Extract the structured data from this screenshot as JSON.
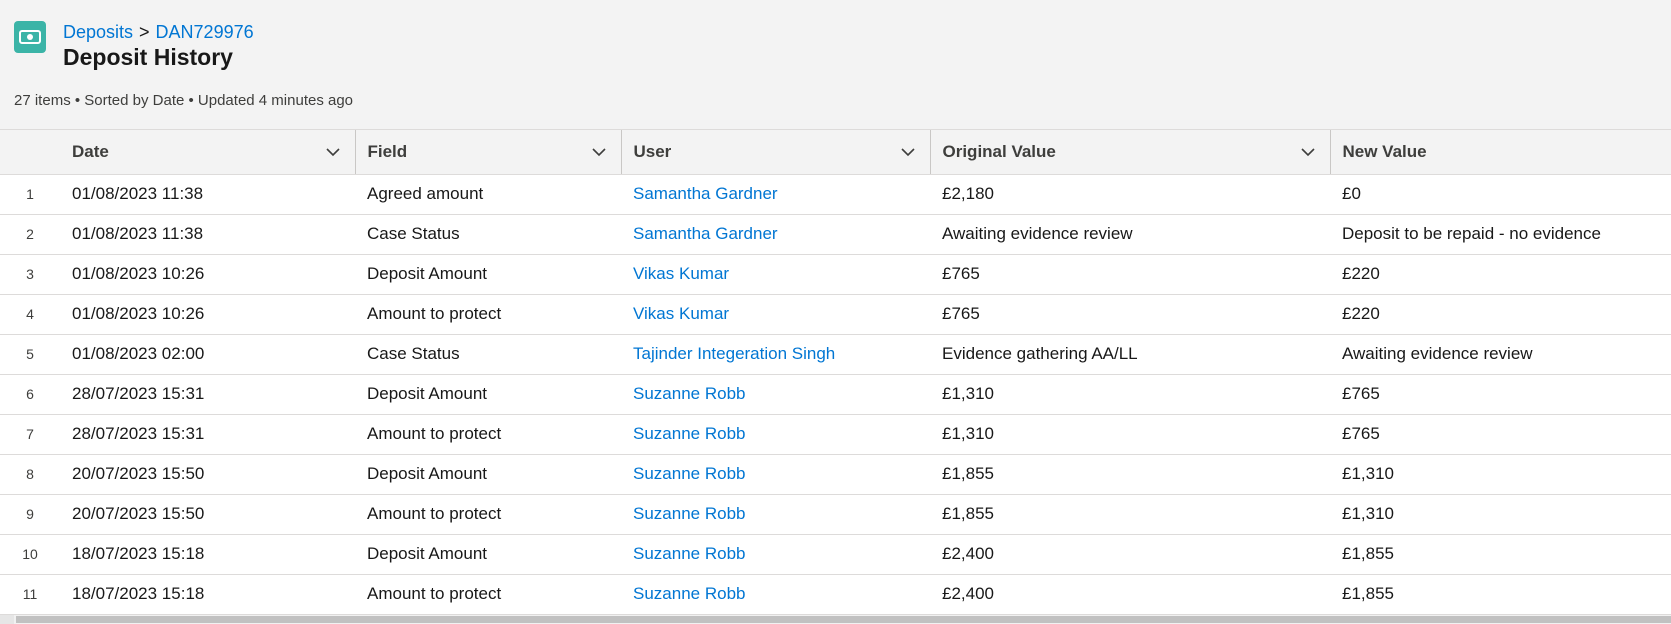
{
  "header": {
    "icon": "deposit-cash-icon",
    "icon_color": "#3bb4a7",
    "breadcrumb": {
      "parent": "Deposits",
      "separator": ">",
      "record": "DAN729976"
    },
    "title": "Deposit History",
    "meta": "27 items • Sorted by Date • Updated 4 minutes ago"
  },
  "table": {
    "columns": [
      {
        "label": "Date"
      },
      {
        "label": "Field"
      },
      {
        "label": "User"
      },
      {
        "label": "Original Value"
      },
      {
        "label": "New Value"
      }
    ],
    "rows": [
      {
        "num": "1",
        "date": "01/08/2023 11:38",
        "field": "Agreed amount",
        "user": "Samantha Gardner",
        "original": "£2,180",
        "new": "£0"
      },
      {
        "num": "2",
        "date": "01/08/2023 11:38",
        "field": "Case Status",
        "user": "Samantha Gardner",
        "original": "Awaiting evidence review",
        "new": "Deposit to be repaid - no evidence"
      },
      {
        "num": "3",
        "date": "01/08/2023 10:26",
        "field": "Deposit Amount",
        "user": "Vikas Kumar",
        "original": "£765",
        "new": "£220"
      },
      {
        "num": "4",
        "date": "01/08/2023 10:26",
        "field": "Amount to protect",
        "user": "Vikas Kumar",
        "original": "£765",
        "new": "£220"
      },
      {
        "num": "5",
        "date": "01/08/2023 02:00",
        "field": "Case Status",
        "user": "Tajinder Integeration Singh",
        "original": "Evidence gathering AA/LL",
        "new": "Awaiting evidence review"
      },
      {
        "num": "6",
        "date": "28/07/2023 15:31",
        "field": "Deposit Amount",
        "user": "Suzanne Robb",
        "original": "£1,310",
        "new": "£765"
      },
      {
        "num": "7",
        "date": "28/07/2023 15:31",
        "field": "Amount to protect",
        "user": "Suzanne Robb",
        "original": "£1,310",
        "new": "£765"
      },
      {
        "num": "8",
        "date": "20/07/2023 15:50",
        "field": "Deposit Amount",
        "user": "Suzanne Robb",
        "original": "£1,855",
        "new": "£1,310"
      },
      {
        "num": "9",
        "date": "20/07/2023 15:50",
        "field": "Amount to protect",
        "user": "Suzanne Robb",
        "original": "£1,855",
        "new": "£1,310"
      },
      {
        "num": "10",
        "date": "18/07/2023 15:18",
        "field": "Deposit Amount",
        "user": "Suzanne Robb",
        "original": "£2,400",
        "new": "£1,855"
      },
      {
        "num": "11",
        "date": "18/07/2023 15:18",
        "field": "Amount to protect",
        "user": "Suzanne Robb",
        "original": "£2,400",
        "new": "£1,855"
      }
    ]
  }
}
